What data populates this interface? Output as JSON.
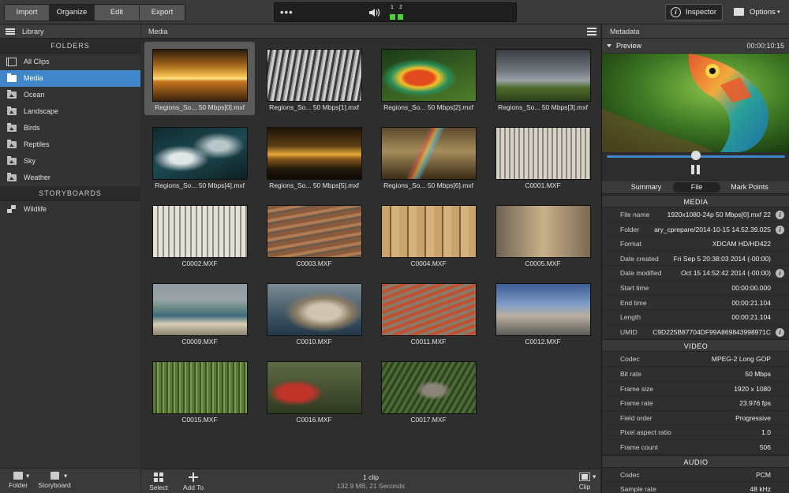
{
  "toolbar": {
    "modes": [
      "Import",
      "Organize",
      "Edit",
      "Export"
    ],
    "active_mode": "Organize",
    "transport_more": "•••",
    "meter_channels": [
      "1",
      "2"
    ],
    "inspector_label": "Inspector",
    "options_label": "Options",
    "options_caret": "▾"
  },
  "library": {
    "title": "Library",
    "folders_header": "FOLDERS",
    "folders": [
      {
        "label": "All Clips",
        "icon": "clips-icon"
      },
      {
        "label": "Media",
        "icon": "folder-icon",
        "selected": true
      },
      {
        "label": "Ocean",
        "icon": "photo-folder-icon"
      },
      {
        "label": "Landscape",
        "icon": "photo-folder-icon"
      },
      {
        "label": "Birds",
        "icon": "photo-folder-icon"
      },
      {
        "label": "Reptiles",
        "icon": "photo-folder-icon"
      },
      {
        "label": "Sky",
        "icon": "photo-folder-icon"
      },
      {
        "label": "Weather",
        "icon": "photo-folder-icon"
      }
    ],
    "storyboards_header": "STORYBOARDS",
    "storyboards": [
      {
        "label": "Wildlife",
        "icon": "storyboard-icon"
      }
    ],
    "footer": {
      "folder_label": "Folder",
      "storyboard_label": "Storyboard"
    }
  },
  "media": {
    "title": "Media",
    "clips": [
      {
        "label": "Regions_So... 50 Mbps[0].mxf",
        "selected": true
      },
      {
        "label": "Regions_So... 50 Mbps[1].mxf"
      },
      {
        "label": "Regions_So... 50 Mbps[2].mxf"
      },
      {
        "label": "Regions_So... 50 Mbps[3].mxf"
      },
      {
        "label": "Regions_So... 50 Mbps[4].mxf"
      },
      {
        "label": "Regions_So... 50 Mbps[5].mxf"
      },
      {
        "label": "Regions_So... 50 Mbps[6].mxf"
      },
      {
        "label": "C0001.MXF"
      },
      {
        "label": "C0002.MXF"
      },
      {
        "label": "C0003.MXF"
      },
      {
        "label": "C0004.MXF"
      },
      {
        "label": "C0005.MXF"
      },
      {
        "label": "C0009.MXF"
      },
      {
        "label": "C0010.MXF"
      },
      {
        "label": "C0011.MXF"
      },
      {
        "label": "C0012.MXF"
      },
      {
        "label": "C0015.MXF"
      },
      {
        "label": "C0016.MXF"
      },
      {
        "label": "C0017.MXF"
      }
    ],
    "footer": {
      "select_label": "Select",
      "add_label": "Add To",
      "count": "1 clip",
      "summary": "132.9 MB, 21 Seconds",
      "clip_label": "Clip"
    }
  },
  "metadata": {
    "title": "Metadata",
    "preview_label": "Preview",
    "timecode": "00:00:10:15",
    "playhead_fraction": 0.5,
    "tabs": [
      "Summary",
      "File",
      "Mark Points"
    ],
    "active_tab": "File",
    "sections": [
      {
        "header": "MEDIA",
        "rows": [
          {
            "key": "File name",
            "value": "22 1920x1080-24p 50 Mbps[0].mxf",
            "info": true
          },
          {
            "key": "Folder",
            "value": "ary_cprepare/2014-10-15 14.52.39.025",
            "info": true
          },
          {
            "key": "Format",
            "value": "XDCAM HD/HD422"
          },
          {
            "key": "Date created",
            "value": "Fri Sep  5 20:38:03 2014 (-00:00)"
          },
          {
            "key": "Date modified",
            "value": "Oct 15 14:52:42 2014 (-00:00)",
            "info": true
          },
          {
            "key": "Start time",
            "value": "00:00:00.000"
          },
          {
            "key": "End time",
            "value": "00:00:21.104"
          },
          {
            "key": "Length",
            "value": "00:00:21.104"
          },
          {
            "key": "UMID",
            "value": "C9D225B87704DF99A869843998971C",
            "info": true
          }
        ]
      },
      {
        "header": "VIDEO",
        "rows": [
          {
            "key": "Codec",
            "value": "MPEG-2 Long GOP"
          },
          {
            "key": "Bit rate",
            "value": "50 Mbps"
          },
          {
            "key": "Frame size",
            "value": "1920 x 1080"
          },
          {
            "key": "Frame rate",
            "value": "23.976 fps"
          },
          {
            "key": "Field order",
            "value": "Progressive"
          },
          {
            "key": "Pixel aspect ratio",
            "value": "1.0"
          },
          {
            "key": "Frame count",
            "value": "506"
          }
        ]
      },
      {
        "header": "AUDIO",
        "rows": [
          {
            "key": "Codec",
            "value": "PCM"
          },
          {
            "key": "Sample rate",
            "value": "48 kHz"
          }
        ]
      }
    ]
  }
}
